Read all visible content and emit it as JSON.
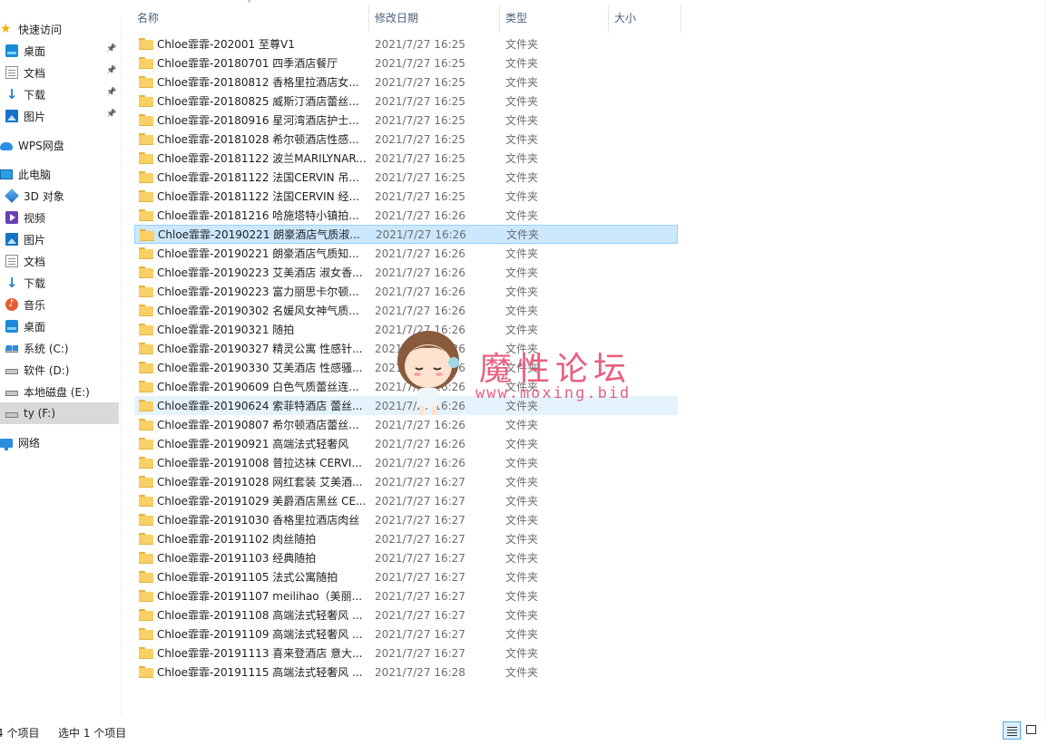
{
  "sidebar": {
    "items": [
      {
        "label": "快速访问",
        "icon": "star-icon",
        "pinned": false
      },
      {
        "label": "桌面",
        "icon": "desktop-icon",
        "pinned": true
      },
      {
        "label": "文档",
        "icon": "documents-icon",
        "pinned": true
      },
      {
        "label": "下载",
        "icon": "downloads-icon",
        "pinned": true
      },
      {
        "label": "图片",
        "icon": "pictures-icon",
        "pinned": true
      },
      {
        "label": "WPS网盘",
        "icon": "cloud-icon",
        "pinned": false
      },
      {
        "label": "此电脑",
        "icon": "computer-icon",
        "pinned": false
      },
      {
        "label": "3D 对象",
        "icon": "3d-objects-icon",
        "pinned": false
      },
      {
        "label": "视频",
        "icon": "video-icon",
        "pinned": false
      },
      {
        "label": "图片",
        "icon": "pictures-icon",
        "pinned": false
      },
      {
        "label": "文档",
        "icon": "documents-icon",
        "pinned": false
      },
      {
        "label": "下载",
        "icon": "downloads-icon",
        "pinned": false
      },
      {
        "label": "音乐",
        "icon": "music-icon",
        "pinned": false
      },
      {
        "label": "桌面",
        "icon": "desktop-icon",
        "pinned": false
      },
      {
        "label": "系统 (C:)",
        "icon": "system-drive-icon",
        "pinned": false
      },
      {
        "label": "软件 (D:)",
        "icon": "drive-icon",
        "pinned": false
      },
      {
        "label": "本地磁盘 (E:)",
        "icon": "drive-icon",
        "pinned": false
      },
      {
        "label": "ty (F:)",
        "icon": "drive-icon",
        "pinned": false,
        "selected": true
      },
      {
        "label": "网络",
        "icon": "network-icon",
        "pinned": false
      }
    ]
  },
  "columns": {
    "name": "名称",
    "date": "修改日期",
    "type": "类型",
    "size": "大小"
  },
  "files": [
    {
      "name": "Chloe霏霏-202001 至尊V1",
      "date": "2021/7/27 16:25",
      "type": "文件夹"
    },
    {
      "name": "Chloe霏霏-20180701 四季酒店餐厅",
      "date": "2021/7/27 16:25",
      "type": "文件夹"
    },
    {
      "name": "Chloe霏霏-20180812 香格里拉酒店女...",
      "date": "2021/7/27 16:25",
      "type": "文件夹"
    },
    {
      "name": "Chloe霏霏-20180825 威斯汀酒店蕾丝...",
      "date": "2021/7/27 16:25",
      "type": "文件夹"
    },
    {
      "name": "Chloe霏霏-20180916 星河湾酒店护士...",
      "date": "2021/7/27 16:25",
      "type": "文件夹"
    },
    {
      "name": "Chloe霏霏-20181028 希尔顿酒店性感...",
      "date": "2021/7/27 16:25",
      "type": "文件夹"
    },
    {
      "name": "Chloe霏霏-20181122 波兰MARILYNAR...",
      "date": "2021/7/27 16:25",
      "type": "文件夹"
    },
    {
      "name": "Chloe霏霏-20181122 法国CERVIN 吊...",
      "date": "2021/7/27 16:25",
      "type": "文件夹"
    },
    {
      "name": "Chloe霏霏-20181122 法国CERVIN 经...",
      "date": "2021/7/27 16:25",
      "type": "文件夹"
    },
    {
      "name": "Chloe霏霏-20181216 哈施塔特小镇拍...",
      "date": "2021/7/27 16:26",
      "type": "文件夹"
    },
    {
      "name": "Chloe霏霏-20190221 朗豪酒店气质淑...",
      "date": "2021/7/27 16:26",
      "type": "文件夹",
      "selected": true
    },
    {
      "name": "Chloe霏霏-20190221 朗豪酒店气质知...",
      "date": "2021/7/27 16:26",
      "type": "文件夹"
    },
    {
      "name": "Chloe霏霏-20190223 艾美酒店 淑女香...",
      "date": "2021/7/27 16:26",
      "type": "文件夹"
    },
    {
      "name": "Chloe霏霏-20190223 富力丽思卡尔顿...",
      "date": "2021/7/27 16:26",
      "type": "文件夹"
    },
    {
      "name": "Chloe霏霏-20190302 名媛风女神气质...",
      "date": "2021/7/27 16:26",
      "type": "文件夹"
    },
    {
      "name": "Chloe霏霏-20190321 随拍",
      "date": "2021/7/27 16:26",
      "type": "文件夹"
    },
    {
      "name": "Chloe霏霏-20190327 精灵公寓 性感针...",
      "date": "2021/7/27 16:26",
      "type": "文件夹"
    },
    {
      "name": "Chloe霏霏-20190330 艾美酒店 性感骚...",
      "date": "2021/7/27 16:26",
      "type": "文件夹"
    },
    {
      "name": "Chloe霏霏-20190609 白色气质蕾丝连...",
      "date": "2021/7/27 16:26",
      "type": "文件夹"
    },
    {
      "name": "Chloe霏霏-20190624 索菲特酒店 蕾丝...",
      "date": "2021/7/27 16:26",
      "type": "文件夹",
      "hover": true
    },
    {
      "name": "Chloe霏霏-20190807 希尔顿酒店蕾丝...",
      "date": "2021/7/27 16:26",
      "type": "文件夹"
    },
    {
      "name": "Chloe霏霏-20190921 高端法式轻奢风",
      "date": "2021/7/27 16:26",
      "type": "文件夹"
    },
    {
      "name": "Chloe霏霏-20191008 普拉达袜 CERVI...",
      "date": "2021/7/27 16:26",
      "type": "文件夹"
    },
    {
      "name": "Chloe霏霏-20191028 网红套装 艾美酒...",
      "date": "2021/7/27 16:27",
      "type": "文件夹"
    },
    {
      "name": "Chloe霏霏-20191029 美爵酒店黑丝 CE...",
      "date": "2021/7/27 16:27",
      "type": "文件夹"
    },
    {
      "name": "Chloe霏霏-20191030 香格里拉酒店肉丝",
      "date": "2021/7/27 16:27",
      "type": "文件夹"
    },
    {
      "name": "Chloe霏霏-20191102 肉丝随拍",
      "date": "2021/7/27 16:27",
      "type": "文件夹"
    },
    {
      "name": "Chloe霏霏-20191103 经典随拍",
      "date": "2021/7/27 16:27",
      "type": "文件夹"
    },
    {
      "name": "Chloe霏霏-20191105 法式公寓随拍",
      "date": "2021/7/27 16:27",
      "type": "文件夹"
    },
    {
      "name": "Chloe霏霏-20191107 meilihao（美丽...",
      "date": "2021/7/27 16:27",
      "type": "文件夹"
    },
    {
      "name": "Chloe霏霏-20191108 高端法式轻奢风 ...",
      "date": "2021/7/27 16:27",
      "type": "文件夹"
    },
    {
      "name": "Chloe霏霏-20191109 高端法式轻奢风 ...",
      "date": "2021/7/27 16:27",
      "type": "文件夹"
    },
    {
      "name": "Chloe霏霏-20191113 喜来登酒店 意大...",
      "date": "2021/7/27 16:27",
      "type": "文件夹"
    },
    {
      "name": "Chloe霏霏-20191115 高端法式轻奢风 ...",
      "date": "2021/7/27 16:28",
      "type": "文件夹"
    }
  ],
  "watermark": {
    "title": "魔性论坛",
    "url": "www.moxing.bid"
  },
  "status": {
    "count": "4 个项目",
    "selected": "选中 1 个项目"
  }
}
